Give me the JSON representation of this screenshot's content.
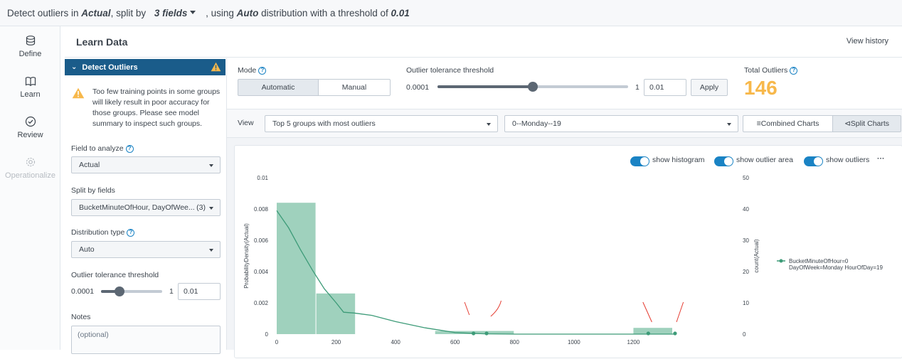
{
  "header": {
    "p1": "Detect outliers in ",
    "field": "Actual",
    "p2": ", split by ",
    "split": "3 fields",
    "p3": " , using ",
    "dist": "Auto",
    "p4": " distribution with a threshold of ",
    "threshold": "0.01"
  },
  "nav": {
    "define": "Define",
    "learn": "Learn",
    "review": "Review",
    "operationalize": "Operationalize"
  },
  "panel": {
    "title": "Learn Data",
    "view_history": "View history",
    "section": "Detect Outliers",
    "warning": "Too few training points in some groups will likely result in poor accuracy for those groups. Please see model summary to inspect such groups.",
    "field_label": "Field to analyze",
    "field_value": "Actual",
    "split_label": "Split by fields",
    "split_value": "BucketMinuteOfHour, DayOfWee...",
    "split_count": "(3)",
    "dist_label": "Distribution type",
    "dist_value": "Auto",
    "thresh_label": "Outlier tolerance threshold",
    "thresh_min": "0.0001",
    "thresh_max": "1",
    "thresh_value": "0.01",
    "thresh_fraction": 0.3,
    "notes_label": "Notes",
    "notes_placeholder": "(optional)"
  },
  "controls": {
    "mode_label": "Mode",
    "mode_auto": "Automatic",
    "mode_manual": "Manual",
    "thresh_label": "Outlier tolerance threshold",
    "thresh_min": "0.0001",
    "thresh_max": "1",
    "thresh_value": "0.01",
    "thresh_fraction": 0.5,
    "apply": "Apply",
    "total_label": "Total Outliers",
    "total_value": "146",
    "view_label": "View",
    "view_select": "Top 5 groups with most outliers",
    "group_select": "0--Monday--19",
    "combined": "Combined Charts",
    "split": "Split Charts",
    "show_histogram": "show histogram",
    "show_outlier_area": "show outlier area",
    "show_outliers": "show outliers",
    "more": "···"
  },
  "colors": {
    "brand": "#1a5c8a",
    "accent": "#1a83c4",
    "total": "#f7b84b",
    "hist": "#9fd1bd",
    "curve": "#3d9b78",
    "outlier": "#e53b30"
  },
  "chart_data": {
    "type": "bar",
    "xlabel": "",
    "ylabel": "ProbabilityDensity(Actual)",
    "ylabel_right": "count(Actual)",
    "xlim": [
      0,
      1400
    ],
    "ylim": [
      0,
      0.01
    ],
    "ylim_right": [
      0,
      50
    ],
    "x_ticks": [
      "0",
      "200",
      "400",
      "600",
      "800",
      "1000",
      "1200"
    ],
    "y_ticks": [
      "0",
      "0.002",
      "0.004",
      "0.006",
      "0.008",
      "0.01"
    ],
    "y_ticks_right": [
      "0",
      "10",
      "20",
      "30",
      "40",
      "50"
    ],
    "histogram": [
      {
        "x0": 0,
        "x1": 133,
        "count": 42
      },
      {
        "x0": 133,
        "x1": 266,
        "count": 13
      },
      {
        "x0": 533,
        "x1": 800,
        "count": 1
      },
      {
        "x0": 1200,
        "x1": 1333,
        "count": 2
      }
    ],
    "density_curve": [
      [
        0,
        0.0079
      ],
      [
        40,
        0.0068
      ],
      [
        80,
        0.0054
      ],
      [
        120,
        0.0041
      ],
      [
        160,
        0.0029
      ],
      [
        200,
        0.002
      ],
      [
        225,
        0.0014
      ],
      [
        260,
        0.00135
      ],
      [
        320,
        0.0012
      ],
      [
        400,
        0.0008
      ],
      [
        500,
        0.0004
      ],
      [
        600,
        0.0001
      ],
      [
        700,
        2e-05
      ],
      [
        800,
        0
      ],
      [
        1340,
        0
      ]
    ],
    "outliers": [
      {
        "x": 662,
        "count": 0
      },
      {
        "x": 706,
        "count": 0
      },
      {
        "x": 1250,
        "count": 0
      },
      {
        "x": 1340,
        "count": 0
      }
    ],
    "legend": "BucketMinuteOfHour=0\nDayOfWeek=Monday HourOfDay=19"
  }
}
